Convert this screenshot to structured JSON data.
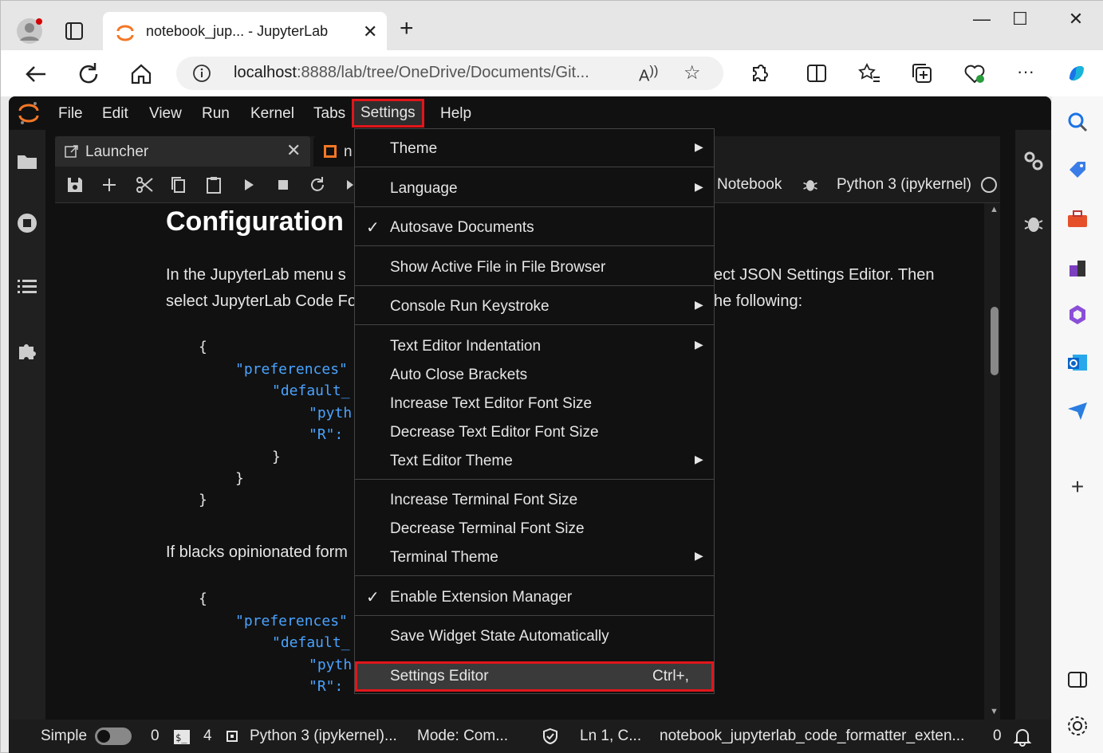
{
  "browser": {
    "tab_title": "notebook_jup... - JupyterLab",
    "new_tab": "+",
    "url_host": "localhost",
    "url_rest": ":8888/lab/tree/OneDrive/Documents/Git...",
    "window_controls": [
      "—",
      "☐",
      "✕"
    ]
  },
  "jupyter": {
    "menus": [
      "File",
      "Edit",
      "View",
      "Run",
      "Kernel",
      "Tabs",
      "Settings",
      "Help"
    ],
    "active_menu": "Settings",
    "tabs": {
      "launcher": "Launcher",
      "notebook": "n"
    },
    "notebook_label": "Notebook",
    "kernel_label": "Python 3 (ipykernel)",
    "content": {
      "heading": "Configuration",
      "para1_line1": "In the JupyterLab menu s",
      "para1_line1_right": "ect JSON Settings Editor. Then",
      "para1_line2": "select JupyterLab Code Fo",
      "para1_line2_right": "he following:",
      "code1": [
        "{",
        "\"preferences\"",
        "\"default_",
        "\"pyth",
        "\"R\":",
        "}",
        "}",
        "}"
      ],
      "para2": "If blacks opinionated form",
      "code2": [
        "{",
        "\"preferences\"",
        "\"default_",
        "\"pyth",
        "\"R\":"
      ]
    },
    "status": {
      "mode_simple": "Simple",
      "terminals": "0",
      "kernels": "4",
      "kernel": "Python 3 (ipykernel)...",
      "mode": "Mode: Com...",
      "position": "Ln 1, C...",
      "file": "notebook_jupyterlab_code_formatter_exten...",
      "notifications": "0"
    },
    "settings_menu": [
      {
        "label": "Theme",
        "submenu": true
      },
      {
        "label": "Language",
        "submenu": true
      },
      {
        "label": "Autosave Documents",
        "checked": true
      },
      {
        "label": "Show Active File in File Browser"
      },
      {
        "label": "Console Run Keystroke",
        "submenu": true
      },
      {
        "label": "Text Editor Indentation",
        "submenu": true
      },
      {
        "label": "Auto Close Brackets"
      },
      {
        "label": "Increase Text Editor Font Size"
      },
      {
        "label": "Decrease Text Editor Font Size"
      },
      {
        "label": "Text Editor Theme",
        "submenu": true
      },
      {
        "label": "Increase Terminal Font Size"
      },
      {
        "label": "Decrease Terminal Font Size"
      },
      {
        "label": "Terminal Theme",
        "submenu": true
      },
      {
        "label": "Enable Extension Manager",
        "checked": true
      },
      {
        "label": "Save Widget State Automatically"
      },
      {
        "label": "Settings Editor",
        "shortcut": "Ctrl+,",
        "highlighted": true
      }
    ]
  },
  "colors": {
    "highlight": "#e0161b",
    "jupyter_orange": "#f37726",
    "code_key": "#4aa3ff"
  }
}
